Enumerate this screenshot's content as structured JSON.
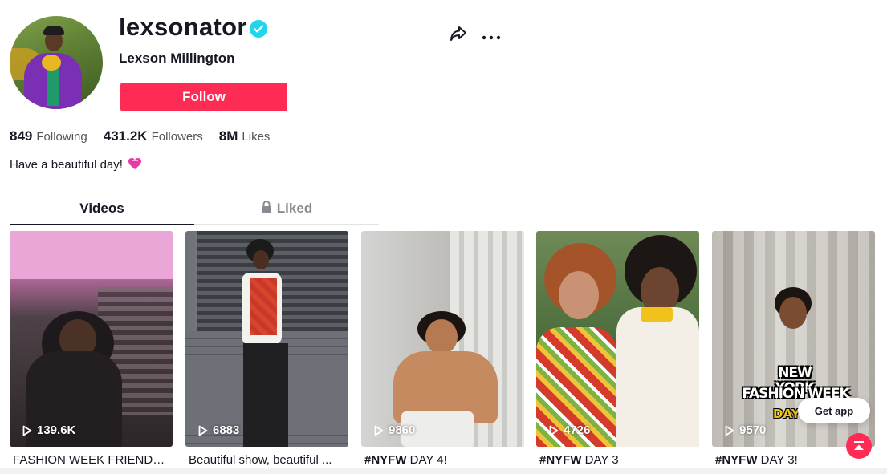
{
  "profile": {
    "username": "lexsonator",
    "nickname": "Lexson Millington",
    "follow_label": "Follow",
    "bio": "Have a beautiful day!",
    "verified": true
  },
  "stats": {
    "following": {
      "value": "849",
      "label": "Following"
    },
    "followers": {
      "value": "431.2K",
      "label": "Followers"
    },
    "likes": {
      "value": "8M",
      "label": "Likes"
    }
  },
  "tabs": {
    "videos": "Videos",
    "liked": "Liked"
  },
  "videos": [
    {
      "views": "139.6K",
      "caption_tag": "",
      "caption_text": "FASHION WEEK FRIENDS..."
    },
    {
      "views": "6883",
      "caption_tag": "",
      "caption_text": "Beautiful show, beautiful ..."
    },
    {
      "views": "9860",
      "caption_tag": "#NYFW",
      "caption_text": " DAY 4!"
    },
    {
      "views": "4726",
      "caption_tag": "#NYFW",
      "caption_text": " DAY 3"
    },
    {
      "views": "9570",
      "caption_tag": "#NYFW",
      "caption_text": " DAY 3!"
    }
  ],
  "overlay_text": {
    "video5_line1": "NEW YORK",
    "video5_line2": "FASHION WEEK",
    "video5_line3": "DAY"
  },
  "floating": {
    "get_app_label": "Get app"
  },
  "colors": {
    "accent": "#fe2c55",
    "verified": "#20d5ec"
  },
  "icons": [
    "verified-badge-icon",
    "share-icon",
    "more-icon",
    "heart-gift-icon",
    "lock-icon",
    "play-icon",
    "scroll-top-icon"
  ]
}
